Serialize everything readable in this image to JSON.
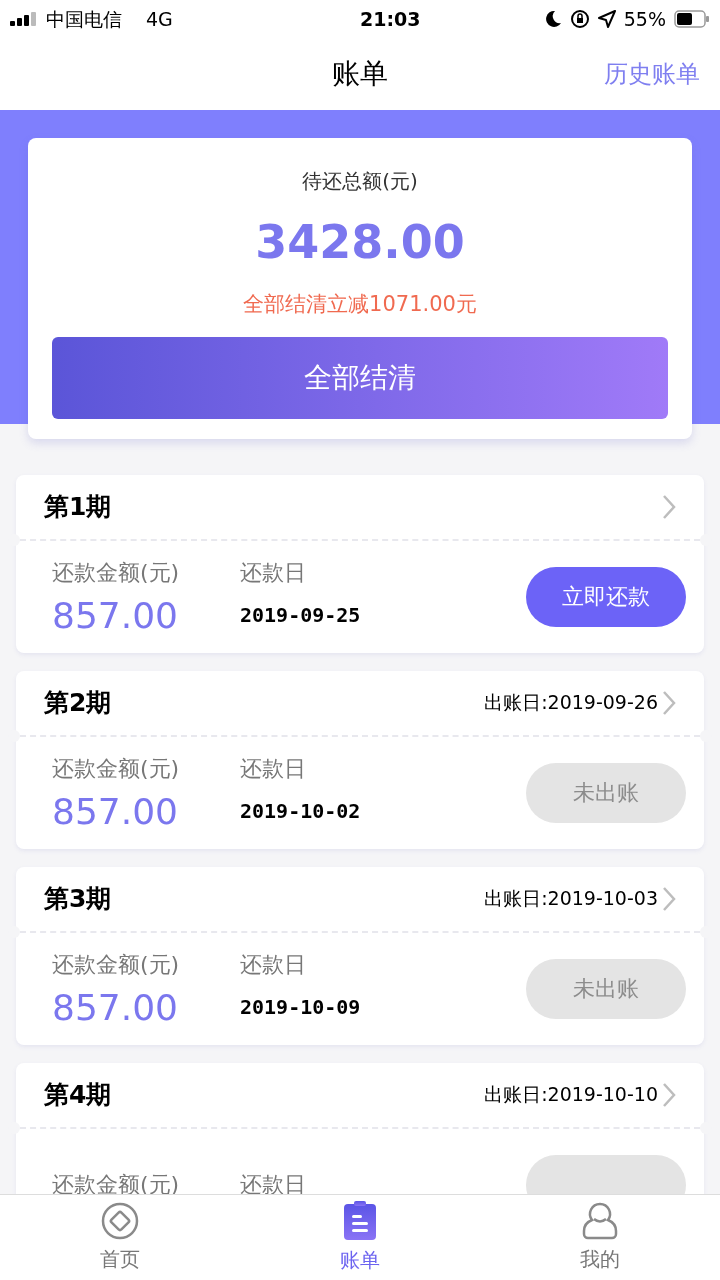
{
  "status_bar": {
    "carrier": "中国电信",
    "network": "4G",
    "time": "21:03",
    "battery": "55%"
  },
  "nav": {
    "title": "账单",
    "action": "历史账单"
  },
  "summary": {
    "label": "待还总额(元)",
    "total": "3428.00",
    "discount": "全部结清立减1071.00元",
    "button": "全部结清"
  },
  "bills": [
    {
      "kind": "due",
      "title": "第1期",
      "amount_label": "还款金额(元)",
      "amount": "857.00",
      "date_label": "还款日",
      "date": "2019-09-25",
      "button": "立即还款"
    },
    {
      "kind": "unbilled",
      "title": "第2期",
      "bill_date": "出账日:2019-09-26",
      "amount_label": "还款金额(元)",
      "amount": "857.00",
      "date_label": "还款日",
      "date": "2019-10-02",
      "button": "未出账"
    },
    {
      "kind": "unbilled",
      "title": "第3期",
      "bill_date": "出账日:2019-10-03",
      "amount_label": "还款金额(元)",
      "amount": "857.00",
      "date_label": "还款日",
      "date": "2019-10-09",
      "button": "未出账"
    },
    {
      "kind": "unbilled",
      "title": "第4期",
      "bill_date": "出账日:2019-10-10",
      "amount_label": "还款金额(元)",
      "date_label": "还款日"
    }
  ],
  "tabs": [
    {
      "kind": "home",
      "label": "首页",
      "selected": false
    },
    {
      "kind": "bill",
      "label": "账单",
      "selected": true
    },
    {
      "kind": "me",
      "label": "我的",
      "selected": false
    }
  ]
}
